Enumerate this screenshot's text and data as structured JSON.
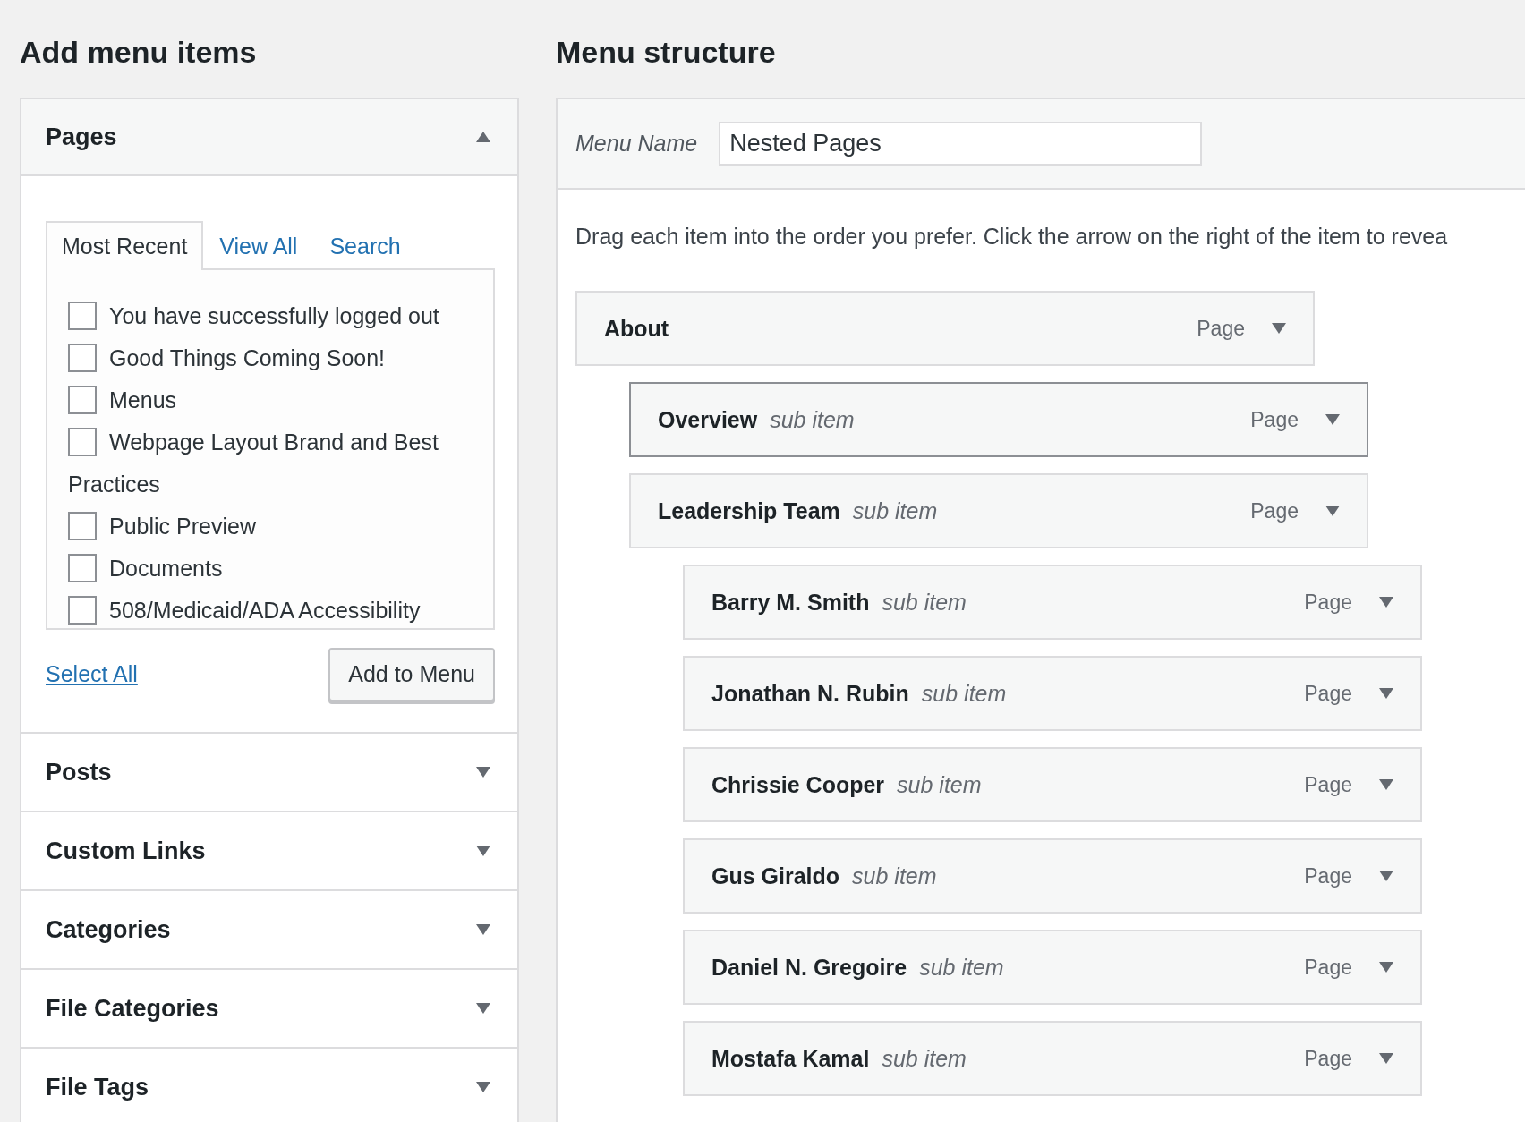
{
  "left": {
    "heading": "Add menu items",
    "sections": [
      {
        "title": "Pages",
        "expanded": true,
        "tabs": [
          {
            "label": "Most Recent",
            "selected": true
          },
          {
            "label": "View All",
            "selected": false
          },
          {
            "label": "Search",
            "selected": false
          }
        ],
        "pages": [
          {
            "label": "You have successfully logged out",
            "checked": false
          },
          {
            "label": "Good Things Coming Soon!",
            "checked": false
          },
          {
            "label": "Menus",
            "checked": false
          },
          {
            "label": "Webpage Layout Brand and Best Practices",
            "checked": false
          },
          {
            "label": "Public Preview",
            "checked": false
          },
          {
            "label": "Documents",
            "checked": false
          },
          {
            "label": "508/Medicaid/ADA Accessibility",
            "checked": false
          }
        ],
        "select_all": "Select All",
        "add_button": "Add to Menu"
      },
      {
        "title": "Posts",
        "expanded": false
      },
      {
        "title": "Custom Links",
        "expanded": false
      },
      {
        "title": "Categories",
        "expanded": false
      },
      {
        "title": "File Categories",
        "expanded": false
      },
      {
        "title": "File Tags",
        "expanded": false
      }
    ]
  },
  "right": {
    "heading": "Menu structure",
    "menu_name_label": "Menu Name",
    "menu_name_value": "Nested Pages",
    "instructions": "Drag each item into the order you prefer. Click the arrow on the right of the item to revea",
    "items": [
      {
        "title": "About",
        "type": "Page",
        "selected": false,
        "children": [
          {
            "title": "Overview",
            "subtitle": "sub item",
            "type": "Page",
            "selected": true
          },
          {
            "title": "Leadership Team",
            "subtitle": "sub item",
            "type": "Page",
            "selected": false,
            "children": [
              {
                "title": "Barry M. Smith",
                "subtitle": "sub item",
                "type": "Page",
                "selected": false
              },
              {
                "title": "Jonathan N. Rubin",
                "subtitle": "sub item",
                "type": "Page",
                "selected": false
              },
              {
                "title": "Chrissie Cooper",
                "subtitle": "sub item",
                "type": "Page",
                "selected": false
              },
              {
                "title": "Gus Giraldo",
                "subtitle": "sub item",
                "type": "Page",
                "selected": false
              },
              {
                "title": "Daniel N. Gregoire",
                "subtitle": "sub item",
                "type": "Page",
                "selected": false
              },
              {
                "title": "Mostafa Kamal",
                "subtitle": "sub item",
                "type": "Page",
                "selected": false
              }
            ]
          }
        ]
      }
    ]
  }
}
